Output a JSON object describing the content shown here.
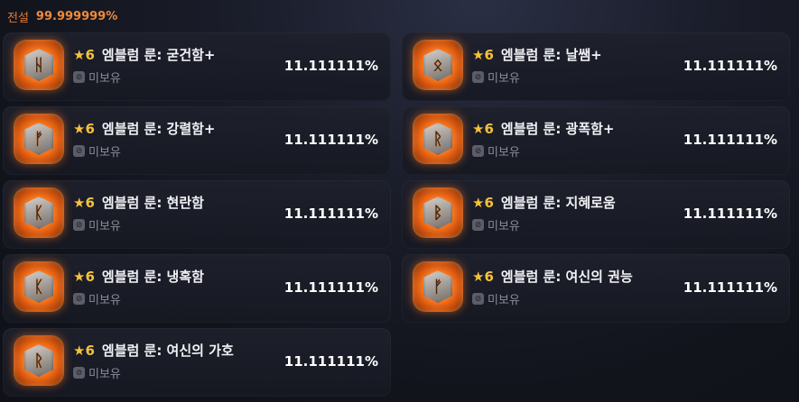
{
  "header": {
    "grade_label": "전설",
    "total_rate": "99.999999%"
  },
  "items": [
    {
      "star": "★6",
      "name": "엠블럼 룬: 굳건함+",
      "owned": "미보유",
      "rate": "11.111111%",
      "glyph": "ᚺ"
    },
    {
      "star": "★6",
      "name": "엠블럼 룬: 날쌤+",
      "owned": "미보유",
      "rate": "11.111111%",
      "glyph": "ᛟ"
    },
    {
      "star": "★6",
      "name": "엠블럼 룬: 강렬함+",
      "owned": "미보유",
      "rate": "11.111111%",
      "glyph": "ᚠ"
    },
    {
      "star": "★6",
      "name": "엠블럼 룬: 광폭함+",
      "owned": "미보유",
      "rate": "11.111111%",
      "glyph": "ᚱ"
    },
    {
      "star": "★6",
      "name": "엠블럼 룬: 현란함",
      "owned": "미보유",
      "rate": "11.111111%",
      "glyph": "ᛕ"
    },
    {
      "star": "★6",
      "name": "엠블럼 룬: 지혜로움",
      "owned": "미보유",
      "rate": "11.111111%",
      "glyph": "ᛒ"
    },
    {
      "star": "★6",
      "name": "엠블럼 룬: 냉혹함",
      "owned": "미보유",
      "rate": "11.111111%",
      "glyph": "ᛕ"
    },
    {
      "star": "★6",
      "name": "엠블럼 룬: 여신의 권능",
      "owned": "미보유",
      "rate": "11.111111%",
      "glyph": "ᚠ"
    },
    {
      "star": "★6",
      "name": "엠블럼 룬: 여신의 가호",
      "owned": "미보유",
      "rate": "11.111111%",
      "glyph": "ᚱ"
    }
  ],
  "icons": {
    "owned_status": "unowned-box-icon",
    "rune": "rune-emblem-icon"
  },
  "colors": {
    "grade": "#e07a3a",
    "star": "#f5c23a",
    "rune_glow": "#ff7a1e"
  }
}
